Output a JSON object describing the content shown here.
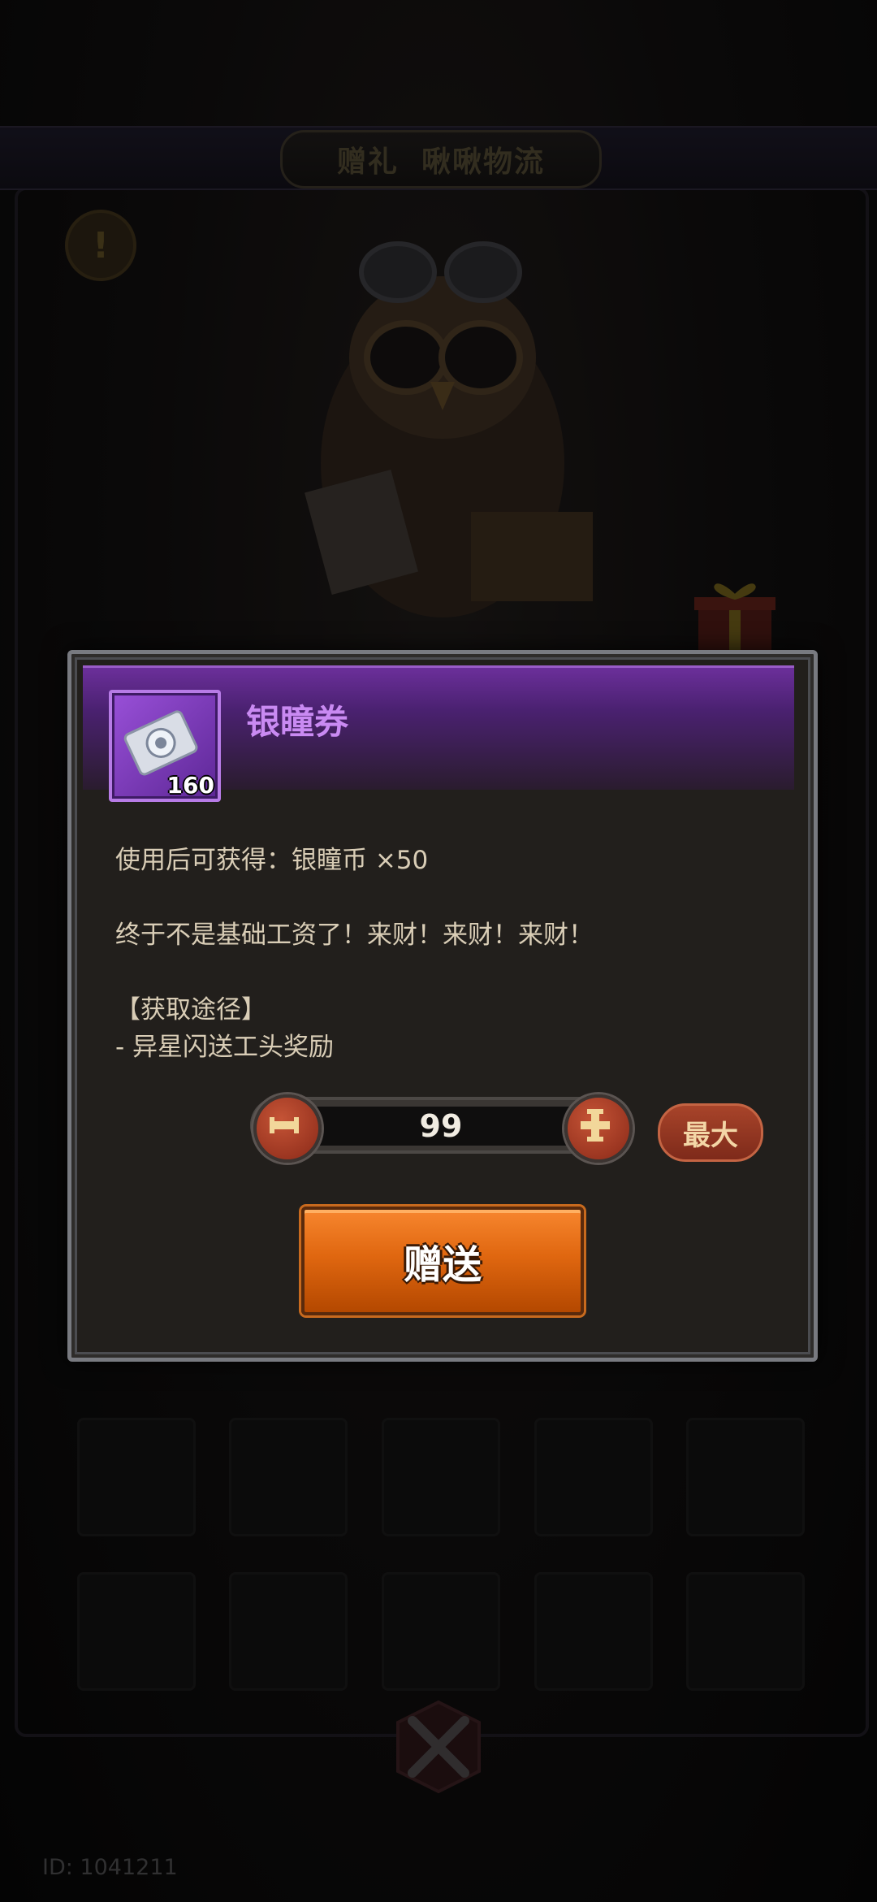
{
  "header": {
    "tab_gift": "赠礼",
    "tab_logistics": "啾啾物流"
  },
  "dialog": {
    "item_name": "银瞳券",
    "item_count": "160",
    "effect_text": "使用后可获得：银瞳币 ×50",
    "flavor_text": "终于不是基础工资了！来财！来财！来财！",
    "source_title": "【获取途径】",
    "source_item": "- 异星闪送工头奖励",
    "quantity": "99",
    "max_label": "最大",
    "send_label": "赠送"
  },
  "footer": {
    "user_id": "ID: 1041211"
  },
  "colors": {
    "accent_purple": "#c98af2",
    "button_orange": "#e06710",
    "stepper_red": "#a8442a"
  },
  "icons": [
    "alert-icon",
    "owl-character",
    "gift-box-icon",
    "ticket-icon",
    "minus-icon",
    "plus-icon",
    "crossed-swords-icon"
  ]
}
